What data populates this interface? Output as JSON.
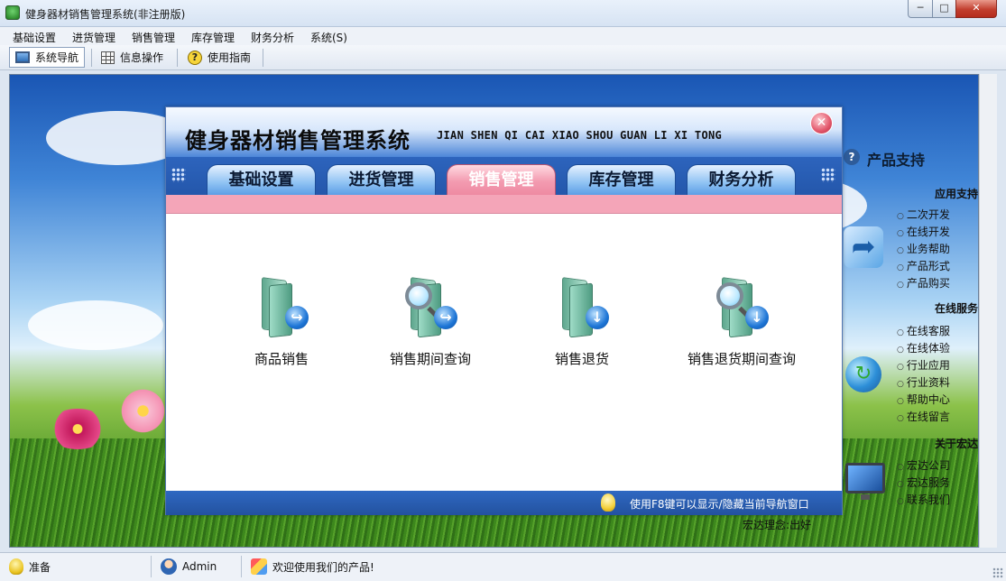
{
  "window": {
    "title": "健身器材销售管理系统(非注册版)",
    "min_glyph": "─",
    "max_glyph": "□",
    "close_glyph": "✕"
  },
  "menubar": {
    "items": [
      {
        "label": "基础设置"
      },
      {
        "label": "进货管理"
      },
      {
        "label": "销售管理"
      },
      {
        "label": "库存管理"
      },
      {
        "label": "财务分析"
      },
      {
        "label": "系统(S)"
      }
    ]
  },
  "toolbar": {
    "items": [
      {
        "label": "系统导航",
        "icon": "monitor-icon",
        "active": true
      },
      {
        "label": "信息操作",
        "icon": "grid-icon",
        "active": false
      },
      {
        "label": "使用指南",
        "icon": "help-icon",
        "active": false
      }
    ],
    "help_glyph": "?"
  },
  "nav_window": {
    "title": "健身器材销售管理系统",
    "subtitle": "JIAN SHEN QI CAI XIAO SHOU GUAN LI XI TONG",
    "close_glyph": "✕",
    "tabs": [
      {
        "label": "基础设置",
        "active": false
      },
      {
        "label": "进货管理",
        "active": false
      },
      {
        "label": "销售管理",
        "active": true
      },
      {
        "label": "库存管理",
        "active": false
      },
      {
        "label": "财务分析",
        "active": false
      }
    ],
    "items": [
      {
        "label": "商品销售",
        "icon": "folder-arrow-icon",
        "badge": "↪"
      },
      {
        "label": "销售期间查询",
        "icon": "folder-search-icon",
        "badge": "↪"
      },
      {
        "label": "销售退货",
        "icon": "folder-down-arrow-icon",
        "badge": "↓"
      },
      {
        "label": "销售退货期间查询",
        "icon": "folder-search-down-icon",
        "badge": "↓"
      }
    ],
    "footer_tip": "使用F8键可以显示/隐藏当前导航窗口"
  },
  "support_panel": {
    "title": "产品支持",
    "title_glyph": "?",
    "sections": [
      {
        "heading": "应用支持",
        "links": [
          "二次开发",
          "在线开发",
          "业务帮助",
          "产品形式",
          "产品购买"
        ]
      },
      {
        "heading": "在线服务",
        "links": [
          "在线客服",
          "在线体验",
          "行业应用",
          "行业资料",
          "帮助中心",
          "在线留言"
        ]
      },
      {
        "heading": "关于宏达",
        "links": [
          "宏达公司",
          "宏达服务",
          "联系我们"
        ]
      }
    ],
    "deco_arrow_glyph": "➦",
    "deco_globe_glyph": "↻"
  },
  "background_text": "宏达理念:出好",
  "statusbar": {
    "status": "准备",
    "user": "Admin",
    "message": "欢迎使用我们的产品!"
  },
  "colors": {
    "nav_header_blue": "#2d64bd",
    "active_tab_pink": "#f39bb0",
    "band_pink": "#f4a5b8"
  }
}
